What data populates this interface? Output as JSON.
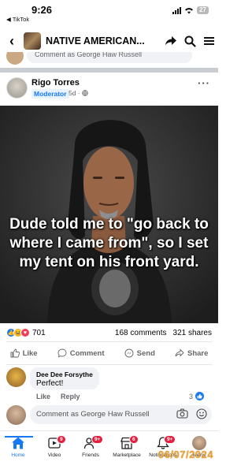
{
  "status_bar": {
    "time": "9:26",
    "back_app": "◀ TikTok",
    "battery": "27"
  },
  "header": {
    "group_name": "NATIVE AMERICAN..."
  },
  "previous_comment": {
    "placeholder": "Comment as George Haw Russell"
  },
  "post": {
    "author": "Rigo Torres",
    "role": "Moderator",
    "time": "5d ·",
    "meme_text": "Dude told me to \"go back to where I came from\", so I set my tent on his front yard."
  },
  "reactions": {
    "count": "701",
    "comments": "168 comments",
    "shares": "321 shares"
  },
  "actions": {
    "like": "Like",
    "comment": "Comment",
    "send": "Send",
    "share": "Share"
  },
  "comment": {
    "author": "Dee Dee Forsythe",
    "text": "Perfect!",
    "like_label": "Like",
    "reply_label": "Reply",
    "like_count": "3"
  },
  "comment_input": {
    "placeholder": "Comment as George Haw Russell"
  },
  "bottom_nav": {
    "home": "Home",
    "video": "Video",
    "video_badge": "9",
    "friends": "Friends",
    "friends_badge": "9+",
    "marketplace": "Marketplace",
    "marketplace_badge": "6",
    "notifications": "Notifications",
    "notifications_badge": "9+",
    "menu": "Menu"
  },
  "datestamp": "06/07/2024",
  "colors": {
    "accent": "#1877f2",
    "badge": "#e41e3f",
    "datestamp": "#e8a23c"
  }
}
